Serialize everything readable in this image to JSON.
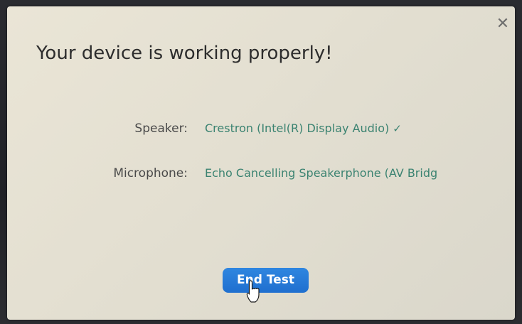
{
  "dialog": {
    "title": "Your device is working properly!",
    "close_icon": "close-icon",
    "speaker": {
      "label": "Speaker:",
      "value": "Crestron (Intel(R) Display Audio)",
      "status_icon": "check-icon",
      "status_glyph": "✓"
    },
    "microphone": {
      "label": "Microphone:",
      "value": "Echo Cancelling Speakerphone (AV Bridg"
    },
    "end_test_label": "End Test",
    "cursor_icon": "hand-pointer-cursor-icon"
  },
  "colors": {
    "accent_button": "#2377d6",
    "device_value": "#3b8371",
    "label_text": "#4a4a4a"
  }
}
